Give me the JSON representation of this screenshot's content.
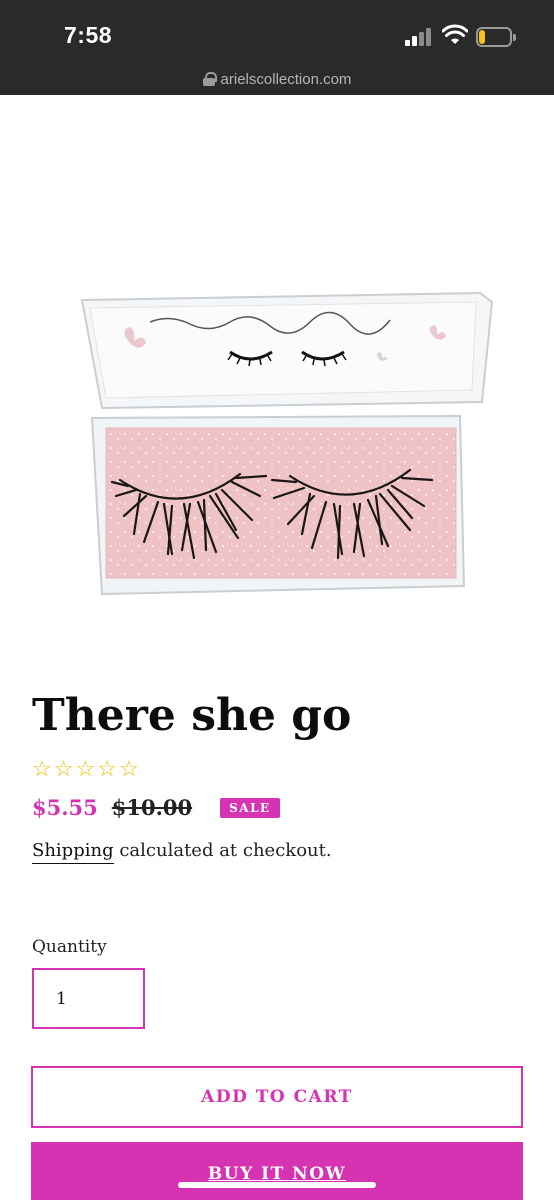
{
  "status_bar": {
    "time": "7:58",
    "signal_icon": "cellular-signal-icon",
    "wifi_icon": "wifi-icon",
    "battery_icon": "battery-low-icon",
    "battery_level": 0.2,
    "battery_color": "#f5c518"
  },
  "url_bar": {
    "lock_icon": "lock-icon",
    "url": "arielscollection.com"
  },
  "product": {
    "image_subject": "mink-eyelashes-in-clear-box",
    "title": "There she go",
    "rating": {
      "filled": 0,
      "max": 5,
      "star_char": "☆",
      "color": "#e6c200"
    },
    "price": {
      "sale": "$5.55",
      "regular": "$10.00",
      "badge": "SALE"
    },
    "shipping": {
      "link": "Shipping",
      "text": " calculated at checkout."
    },
    "quantity": {
      "label": "Quantity",
      "value": "1"
    },
    "buttons": {
      "add_to_cart": "ADD TO CART",
      "buy_it_now": "BUY IT NOW"
    }
  },
  "colors": {
    "accent": "#d633b3",
    "topbar_bg": "#2a2a2a"
  }
}
